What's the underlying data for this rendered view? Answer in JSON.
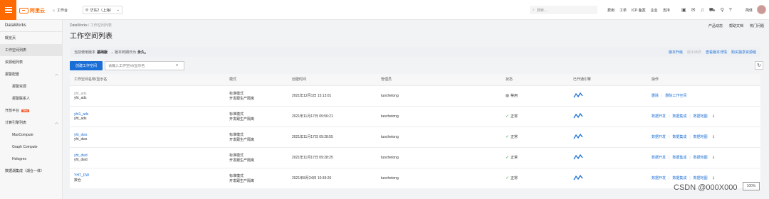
{
  "topbar": {
    "brand": "阿里云",
    "workbench": "工作台",
    "region": "华东2（上海）",
    "search_placeholder": "搜索...",
    "links": [
      "费用",
      "工单",
      "ICP 备案",
      "企业",
      "支持"
    ],
    "lang": "简体"
  },
  "sidebar": {
    "title": "DataWorks",
    "items": [
      {
        "label": "概览页",
        "type": "top",
        "active": false
      },
      {
        "label": "工作空间列表",
        "type": "top",
        "active": true
      },
      {
        "label": "资源组列表",
        "type": "top",
        "active": false
      },
      {
        "label": "报警配置",
        "type": "group",
        "active": false
      },
      {
        "label": "报警资源",
        "type": "sub",
        "active": false
      },
      {
        "label": "报警联系人",
        "type": "sub",
        "active": false
      },
      {
        "label": "开放平台",
        "type": "top",
        "badge": "New",
        "active": false
      },
      {
        "label": "计算引擎列表",
        "type": "group",
        "active": false
      },
      {
        "label": "MaxCompute",
        "type": "sub",
        "active": false
      },
      {
        "label": "Graph Compute",
        "type": "sub",
        "active": false
      },
      {
        "label": "Hologres",
        "type": "sub",
        "active": false
      },
      {
        "label": "数据湖集成（湖仓一体）",
        "type": "top",
        "active": false
      }
    ]
  },
  "header": {
    "breadcrumb_root": "DataWorks",
    "breadcrumb_sep": "/",
    "breadcrumb_current": "工作空间列表",
    "title": "工作空间列表",
    "links": [
      "产品动态",
      "帮助文档",
      "热门问题"
    ]
  },
  "infobar": {
    "prefix": "当前使用版本",
    "edition": "基础版",
    "mid": "，版本到期日为",
    "expire": "永久。",
    "actions": [
      {
        "label": "版本升级",
        "disabled": false
      },
      {
        "label": "版本续费",
        "disabled": true
      },
      {
        "label": "查看版本详情",
        "disabled": false
      },
      {
        "label": "购买独享资源组",
        "disabled": false
      }
    ]
  },
  "toolbar": {
    "create_label": "创建工作空间",
    "search_placeholder": "请输入工作空间/显示名"
  },
  "table": {
    "columns": [
      "工作空间名称/显示名",
      "模式",
      "创建时间",
      "管理员",
      "状态",
      "已开通引擎",
      "操作"
    ],
    "rows": [
      {
        "name": "yht_ads",
        "display": "yht_ads",
        "mode": "标准模式",
        "mode_sub": "开发跟生产隔离",
        "created": "2021年12月1日 15:13:01",
        "admin": "tuochetong",
        "status": "禁用",
        "status_type": "disabled",
        "actions": [
          "删除",
          "删除工作空间"
        ],
        "more": false
      },
      {
        "name": "yht1_ads",
        "display": "yht_ads",
        "mode": "标准模式",
        "mode_sub": "开发跟生产隔离",
        "created": "2021年11月17日 09:56:21",
        "admin": "tuochetong",
        "status": "正常",
        "status_type": "ok",
        "actions": [
          "数据开发",
          "数据集成",
          "数据地图"
        ],
        "more": true
      },
      {
        "name": "yht_dws",
        "display": "yht_dws",
        "mode": "标准模式",
        "mode_sub": "开发跟生产隔离",
        "created": "2021年11月17日 09:28:55",
        "admin": "tuochetong",
        "status": "正常",
        "status_type": "ok",
        "actions": [
          "数据开发",
          "数据集成",
          "数据地图"
        ],
        "more": true
      },
      {
        "name": "yht_dwd",
        "display": "yht_dwd",
        "mode": "标准模式",
        "mode_sub": "开发跟生产隔离",
        "created": "2021年11月17日 09:28:25",
        "admin": "tuochetong",
        "status": "正常",
        "status_type": "ok",
        "actions": [
          "数据开发",
          "数据集成",
          "数据地图"
        ],
        "more": true
      },
      {
        "name": "YHT_DW",
        "display": "数仓",
        "mode": "标准模式",
        "mode_sub": "开发跟生产隔离",
        "created": "2021年8月24日 10:39:26",
        "admin": "tuochetong",
        "status": "正常",
        "status_type": "ok",
        "actions": [
          "数据开发",
          "数据集成",
          "数据地图"
        ],
        "more": true
      }
    ]
  },
  "watermark": "CSDN @000X000",
  "zoom": "100%",
  "colors": {
    "brand": "#ff6a00",
    "primary": "#1a6fd6",
    "success": "#28a745"
  }
}
